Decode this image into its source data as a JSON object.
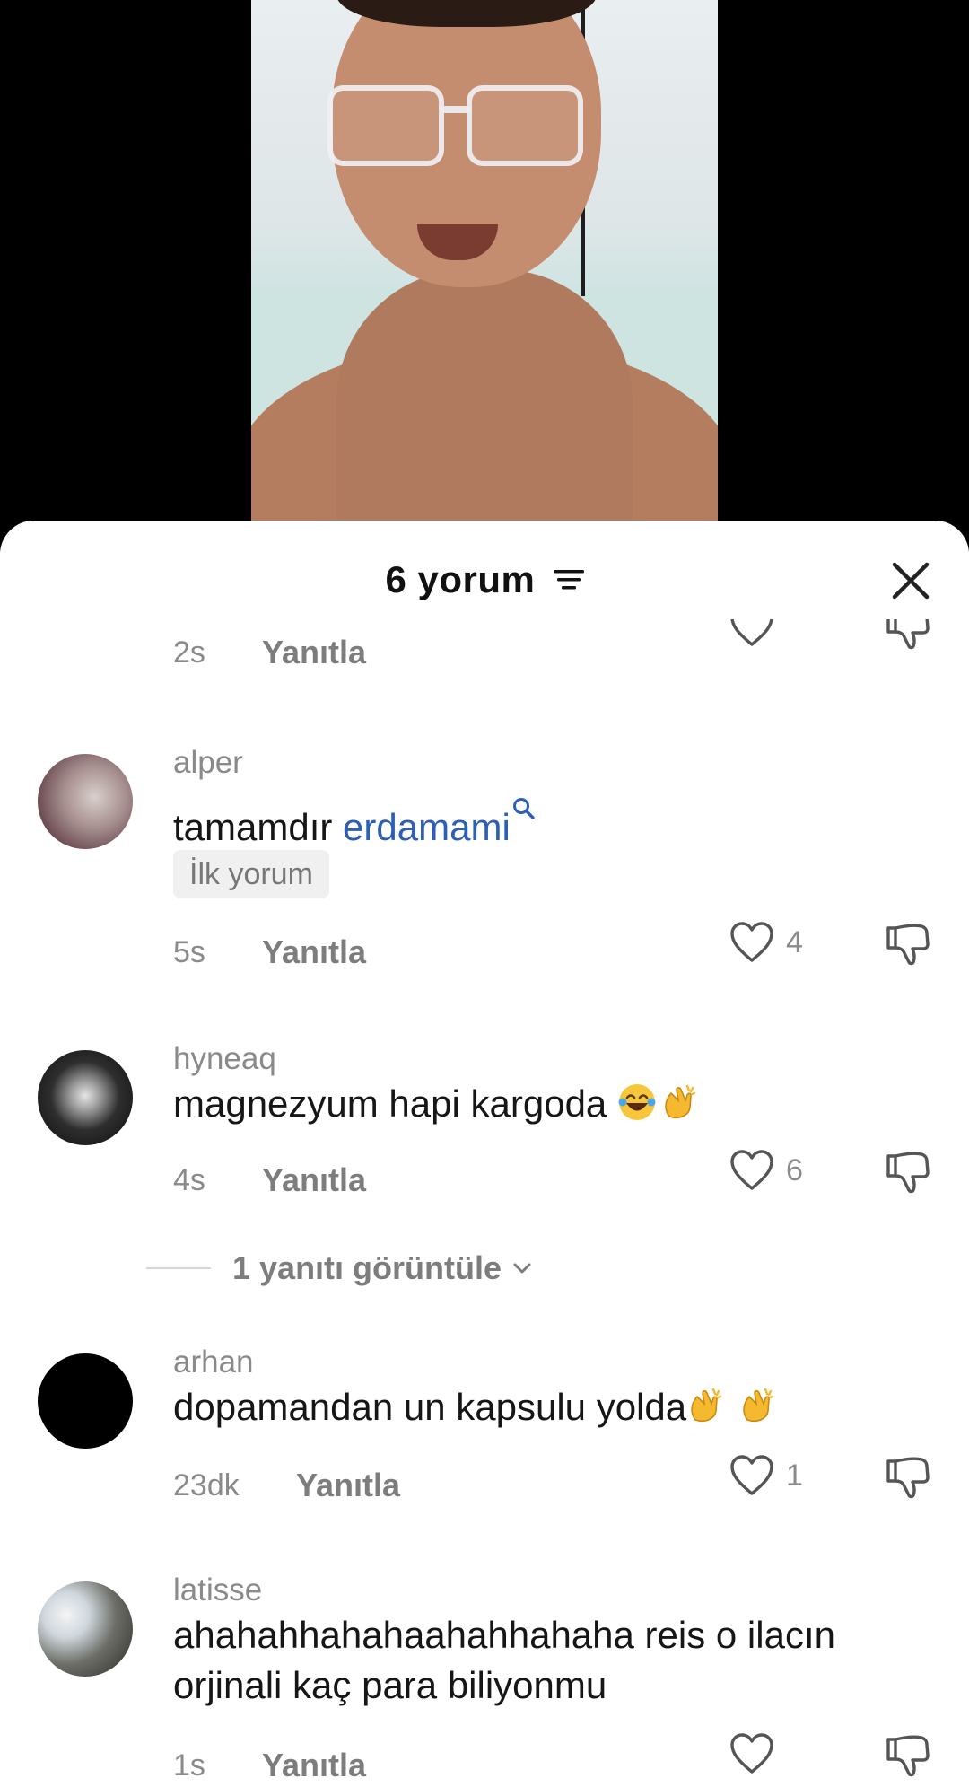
{
  "header": {
    "title": "6 yorum"
  },
  "icons": {
    "sort": "sort-lines-icon",
    "close": "close-x-icon",
    "like": "heart-outline-icon",
    "dislike": "thumbs-down-outline-icon",
    "search_hint": "search-icon",
    "chevron": "chevron-down-icon"
  },
  "colors": {
    "mention": "#2d5fb4",
    "meta": "#8a8a8a",
    "text": "#161616"
  },
  "partial_comment": {
    "time": "2s",
    "reply_label": "Yanıtla"
  },
  "comments": [
    {
      "username": "alper",
      "text_prefix": "tamamdır ",
      "mention": "erdamami",
      "badge": "İlk yorum",
      "time": "5s",
      "reply_label": "Yanıtla",
      "likes": "4"
    },
    {
      "username": "hyneaq",
      "text": "magnezyum hapi kargoda ",
      "emojis": [
        "laughing-tears-emoji",
        "clapping-hands-emoji"
      ],
      "time": "4s",
      "reply_label": "Yanıtla",
      "likes": "6",
      "view_replies": "1 yanıtı görüntüle"
    },
    {
      "username": "arhan",
      "text": "dopamandan un kapsulu yolda",
      "emojis": [
        "clapping-hands-emoji",
        "clapping-hands-emoji"
      ],
      "time": "23dk",
      "reply_label": "Yanıtla",
      "likes": "1"
    },
    {
      "username": "latisse",
      "text_line1": "ahahahhahahaahahhahaha reis o ilacın",
      "text_line2": "orjinali kaç para biliyonmu",
      "time": "1s",
      "reply_label": "Yanıtla",
      "likes": ""
    }
  ]
}
